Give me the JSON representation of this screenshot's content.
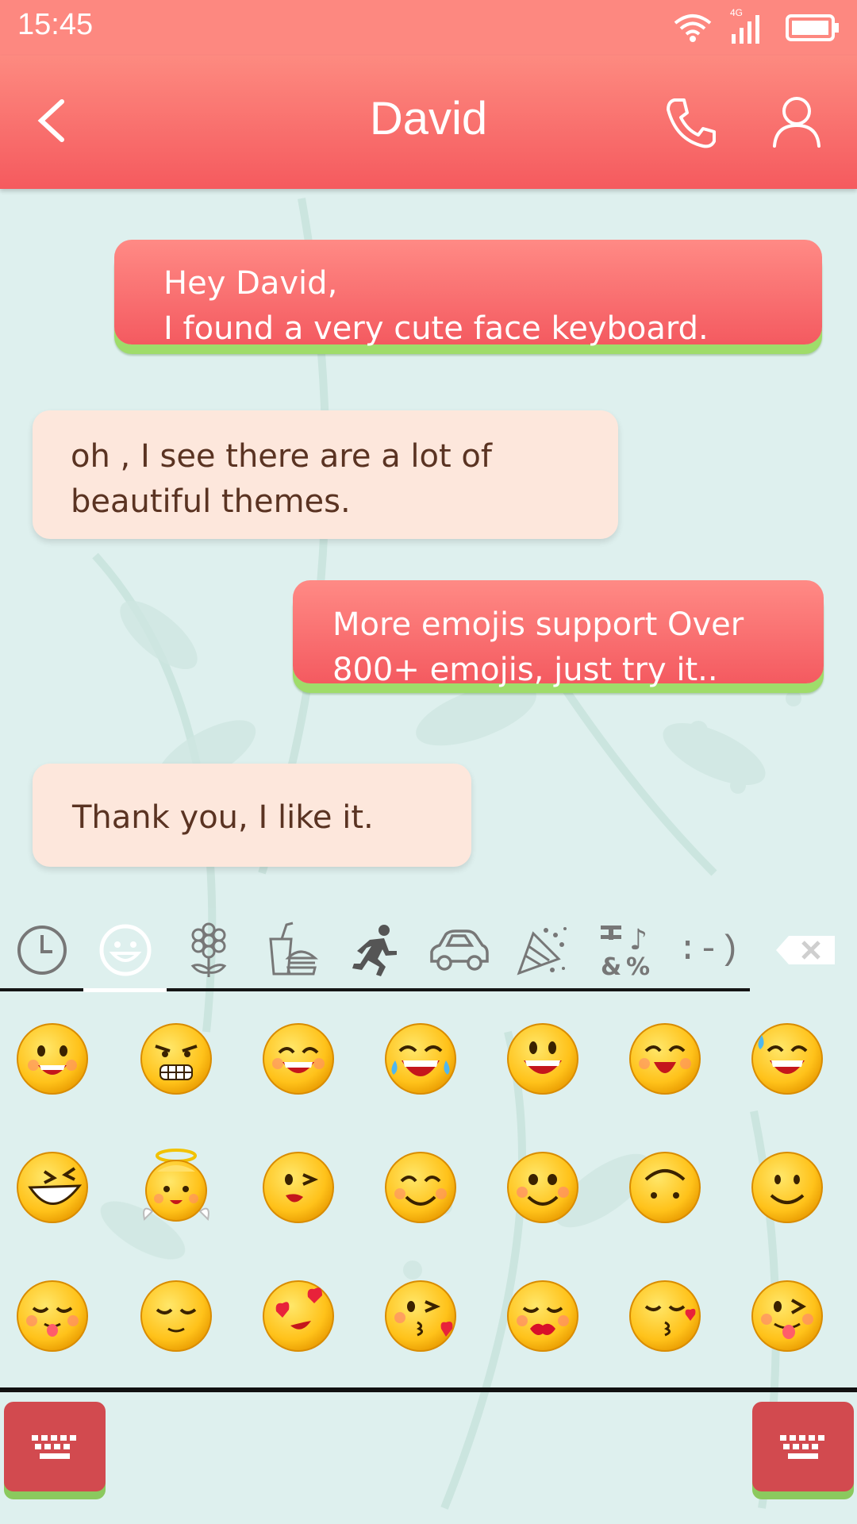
{
  "status": {
    "time": "15:45",
    "network": "4G"
  },
  "header": {
    "title": "David"
  },
  "messages": [
    {
      "dir": "out",
      "text": "Hey David,\nI found a very cute face keyboard."
    },
    {
      "dir": "in",
      "text": "oh ,  I see there are a lot of\nbeautiful themes."
    },
    {
      "dir": "out",
      "text": "More emojis support Over\n800+ emojis, just try it.."
    },
    {
      "dir": "in",
      "text": "Thank you,  I like it."
    }
  ],
  "keyboard": {
    "categories": [
      "recent-icon",
      "smiley-icon",
      "flower-icon",
      "food-icon",
      "activity-icon",
      "car-icon",
      "celebration-icon",
      "symbols-icon",
      "emoticon-icon"
    ],
    "active_category": "smiley-icon",
    "emoticon_text": ":-)",
    "emojis": [
      [
        "grinning",
        "grimacing",
        "grin",
        "joy",
        "smiley",
        "laughing",
        "sweat-smile"
      ],
      [
        "laughing-squint",
        "innocent",
        "wink",
        "blush",
        "smiling-rosy",
        "upside-smile",
        "slight-smile"
      ],
      [
        "relieved-tongue",
        "pensive",
        "heart-eyes",
        "kissing-heart",
        "kissing-lips",
        "kissing-closed",
        "tongue-wink"
      ]
    ]
  },
  "colors": {
    "header": "#f55a5e",
    "outgoing_bubble": "#f45a60",
    "bubble_underline": "#9fdc6a",
    "incoming_bubble": "#fde7dc",
    "background": "#def0ee"
  }
}
